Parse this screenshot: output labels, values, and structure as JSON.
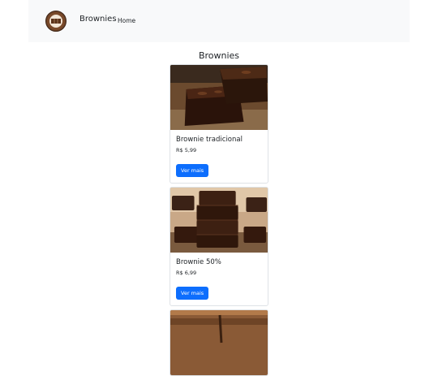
{
  "navbar": {
    "logo_text": "Brownies",
    "brand": "Brownies",
    "links": [
      {
        "label": "Home"
      }
    ]
  },
  "main": {
    "title": "Brownies",
    "cards": [
      {
        "title": "Brownie tradicional",
        "price": "R$ 5,99",
        "button": "Ver mais"
      },
      {
        "title": "Brownie 50%",
        "price": "R$ 6,99",
        "button": "Ver mais"
      },
      {
        "title": "",
        "price": "",
        "button": ""
      }
    ]
  },
  "colors": {
    "navbar_bg": "#f8f9fa",
    "button_bg": "#0d6efd",
    "text": "#212529"
  }
}
